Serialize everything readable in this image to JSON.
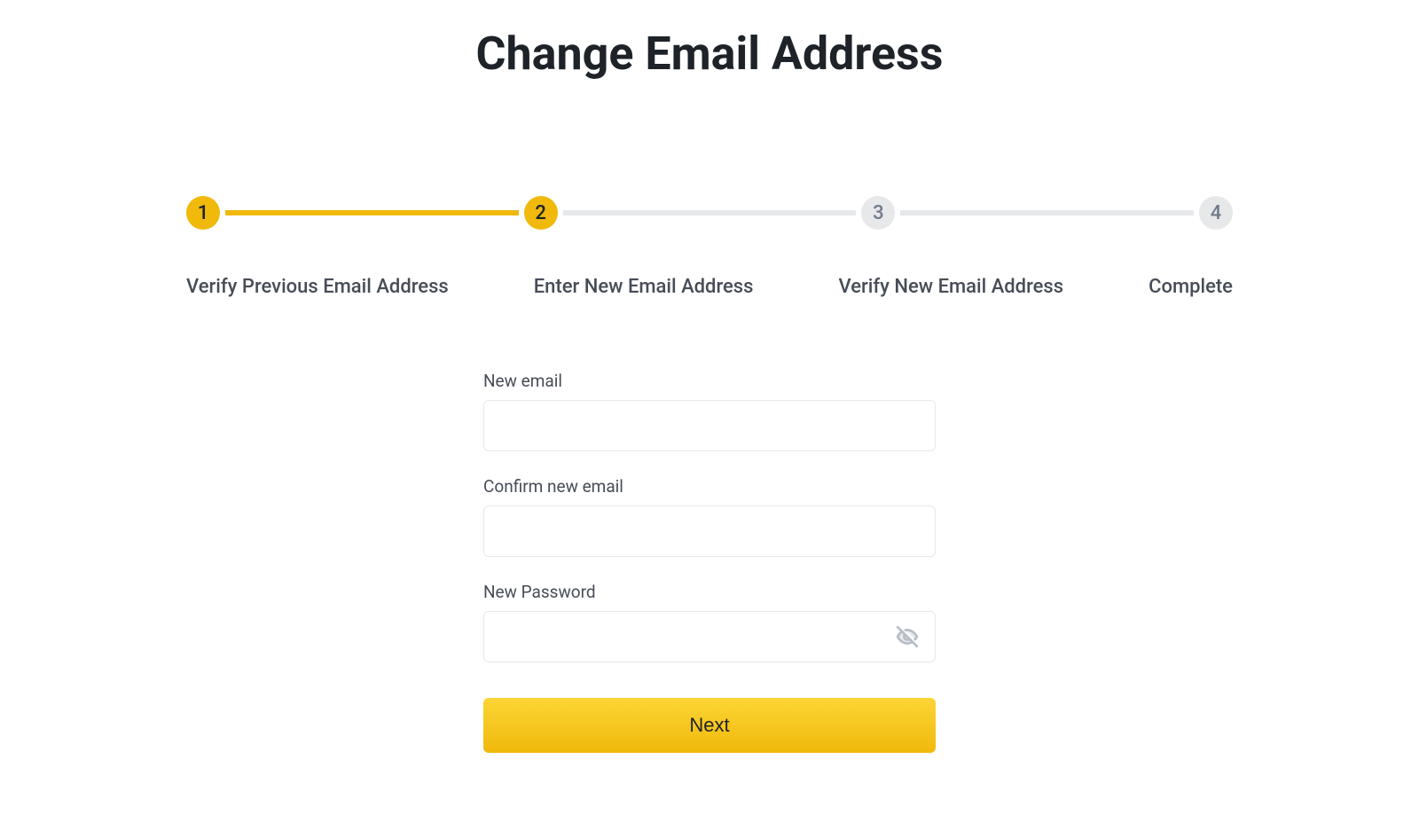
{
  "page": {
    "title": "Change Email Address"
  },
  "stepper": {
    "steps": [
      {
        "number": "1",
        "label": "Verify Previous Email Address",
        "state": "active"
      },
      {
        "number": "2",
        "label": "Enter New Email Address",
        "state": "active"
      },
      {
        "number": "3",
        "label": "Verify New Email Address",
        "state": "inactive"
      },
      {
        "number": "4",
        "label": "Complete",
        "state": "inactive"
      }
    ]
  },
  "form": {
    "new_email": {
      "label": "New email",
      "value": ""
    },
    "confirm_email": {
      "label": "Confirm new email",
      "value": ""
    },
    "new_password": {
      "label": "New Password",
      "value": ""
    },
    "next_button": "Next"
  },
  "colors": {
    "accent": "#f0b90b",
    "text_primary": "#1e2329",
    "text_secondary": "#474d57",
    "inactive": "#e6e8ea"
  }
}
